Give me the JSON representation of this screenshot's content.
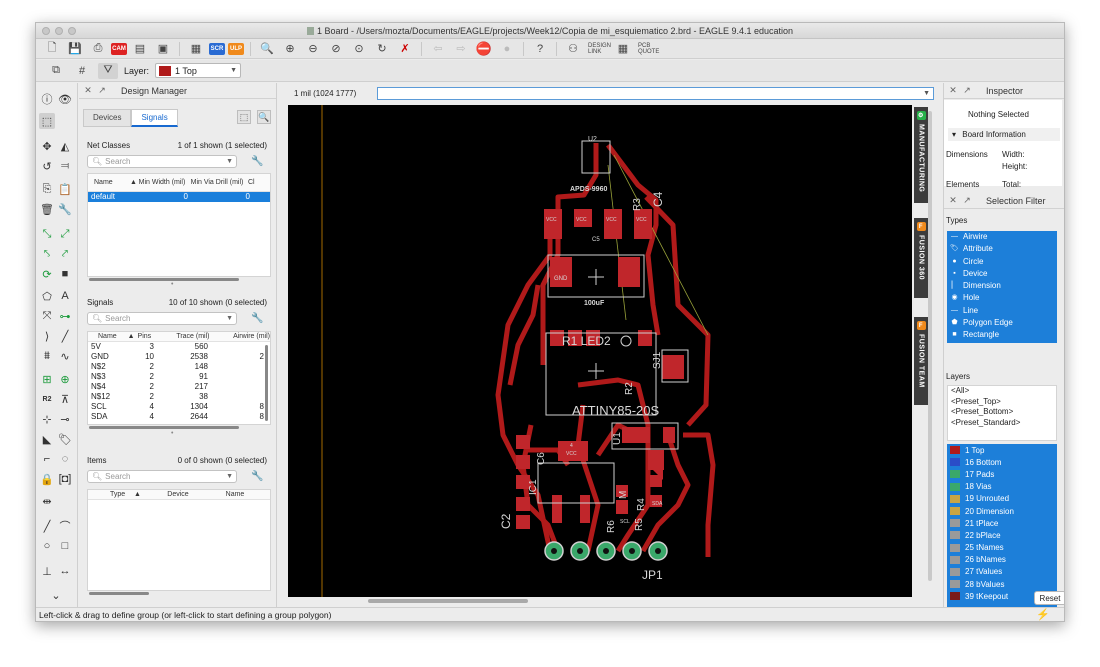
{
  "window": {
    "title": "1 Board - /Users/mozta/Documents/EAGLE/projects/Week12/Copia de mi_esquiematico 2.brd - EAGLE 9.4.1 education"
  },
  "toolbar": {
    "scr": "SCR",
    "ulp": "ULP",
    "design_link": "DESIGN LINK",
    "pcb_quote": "PCB QUOTE"
  },
  "layerbar": {
    "label": "Layer:",
    "value": "1 Top",
    "color": "#b01a1a"
  },
  "design_manager": {
    "title": "Design Manager",
    "tabs": [
      "Devices",
      "Signals"
    ],
    "active_tab": "Signals",
    "net_classes": {
      "title": "Net Classes",
      "count": "1 of 1 shown (1 selected)",
      "search_placeholder": "Search",
      "columns": [
        "Name",
        "Min Width (mil)",
        "Min Via Drill (mil)",
        "Cl"
      ],
      "rows": [
        [
          "default",
          "0",
          "0"
        ]
      ]
    },
    "signals": {
      "title": "Signals",
      "count": "10 of 10 shown (0 selected)",
      "search_placeholder": "Search",
      "columns": [
        "Name",
        "Pins",
        "Trace (mil)",
        "Airwire (mil)"
      ],
      "rows": [
        [
          "5V",
          "3",
          "560",
          ""
        ],
        [
          "GND",
          "10",
          "2538",
          "2"
        ],
        [
          "N$2",
          "2",
          "148",
          ""
        ],
        [
          "N$3",
          "2",
          "91",
          ""
        ],
        [
          "N$4",
          "2",
          "217",
          ""
        ],
        [
          "N$12",
          "2",
          "38",
          ""
        ],
        [
          "SCL",
          "4",
          "1304",
          "8"
        ],
        [
          "SDA",
          "4",
          "2644",
          "8"
        ]
      ]
    },
    "items": {
      "title": "Items",
      "count": "0 of 0 shown (0 selected)",
      "search_placeholder": "Search",
      "columns": [
        "Type",
        "Device",
        "Name"
      ]
    }
  },
  "canvas": {
    "coords": "1 mil (1024 1777)",
    "command_value": "",
    "side_tabs": [
      "MANUFACTURING",
      "FUSION 360",
      "FUSION TEAM"
    ],
    "labels": {
      "u2": "U2",
      "apds": "APDS-9960",
      "vcc": "VCC",
      "gnd": "GND",
      "c5": "C5",
      "c4": "C4",
      "r3": "R3",
      "val": "100uF",
      "led": "R1 LED2",
      "sj1": "SJ1",
      "r2": "R2",
      "attiny": "ATTINY85-20S",
      "u1": "U1",
      "ic1": "IC1",
      "c2": "C2",
      "c6": "C6",
      "m": "M",
      "r4": "R4",
      "r5": "R5",
      "r6": "R6",
      "jp1": "JP1",
      "scl": "SCL",
      "sda": "SDA",
      "n4": "4"
    }
  },
  "inspector": {
    "title": "Inspector",
    "nothing": "Nothing Selected",
    "board_info": "Board Information",
    "dimensions": "Dimensions",
    "width": "Width:",
    "height": "Height:",
    "elements": "Elements",
    "total": "Total:"
  },
  "selection_filter": {
    "title": "Selection Filter",
    "types_label": "Types",
    "types": [
      {
        "name": "Airwire",
        "icon": "line-icon"
      },
      {
        "name": "Attribute",
        "icon": "tag-icon"
      },
      {
        "name": "Circle",
        "icon": "circle-icon"
      },
      {
        "name": "Device",
        "icon": "device-icon"
      },
      {
        "name": "Dimension",
        "icon": "dimension-icon"
      },
      {
        "name": "Hole",
        "icon": "hole-icon"
      },
      {
        "name": "Line",
        "icon": "line-icon"
      },
      {
        "name": "Polygon Edge",
        "icon": "polygon-icon"
      },
      {
        "name": "Rectangle",
        "icon": "rect-icon"
      }
    ],
    "layers_label": "Layers",
    "presets": [
      "<All>",
      "<Preset_Top>",
      "<Preset_Bottom>",
      "<Preset_Standard>"
    ],
    "layers": [
      {
        "name": "1 Top",
        "color": "#b01a1a"
      },
      {
        "name": "16 Bottom",
        "color": "#2a4dc8"
      },
      {
        "name": "17 Pads",
        "color": "#3aa86a"
      },
      {
        "name": "18 Vias",
        "color": "#3aa86a"
      },
      {
        "name": "19 Unrouted",
        "color": "#c9a544"
      },
      {
        "name": "20 Dimension",
        "color": "#c9a544"
      },
      {
        "name": "21 tPlace",
        "color": "#9a9a9a"
      },
      {
        "name": "22 bPlace",
        "color": "#9a9a9a"
      },
      {
        "name": "25 tNames",
        "color": "#9a9a9a"
      },
      {
        "name": "26 bNames",
        "color": "#9a9a9a"
      },
      {
        "name": "27 tValues",
        "color": "#9a9a9a"
      },
      {
        "name": "28 bValues",
        "color": "#9a9a9a"
      },
      {
        "name": "39 tKeepout",
        "color": "#7a1a1a"
      }
    ],
    "reset": "Reset"
  },
  "status": {
    "text": "Left-click & drag to define group (or left-click to start defining a group polygon)"
  }
}
